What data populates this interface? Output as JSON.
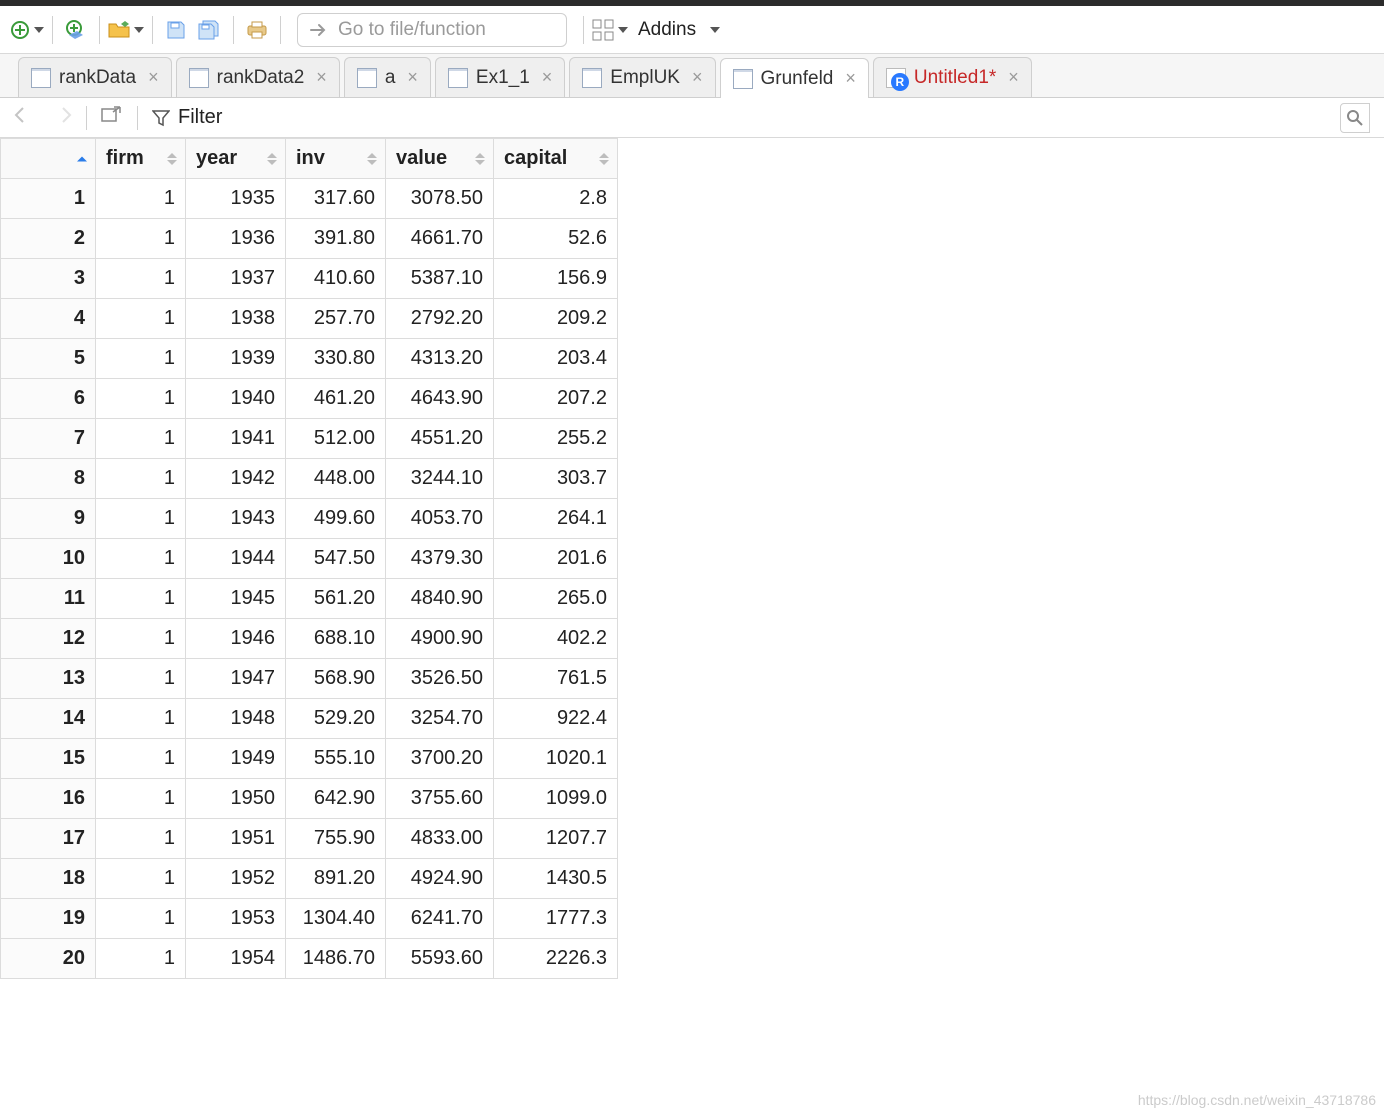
{
  "toolbar": {
    "goto_placeholder": "Go to file/function",
    "addins_label": "Addins"
  },
  "tabs": [
    {
      "label": "rankData",
      "kind": "data",
      "active": false
    },
    {
      "label": "rankData2",
      "kind": "data",
      "active": false
    },
    {
      "label": "a",
      "kind": "data",
      "active": false
    },
    {
      "label": "Ex1_1",
      "kind": "data",
      "active": false
    },
    {
      "label": "EmplUK",
      "kind": "data",
      "active": false
    },
    {
      "label": "Grunfeld",
      "kind": "data",
      "active": true
    },
    {
      "label": "Untitled1*",
      "kind": "script",
      "active": false,
      "unsaved": true
    }
  ],
  "subbar": {
    "filter_label": "Filter"
  },
  "table": {
    "columns": [
      "firm",
      "year",
      "inv",
      "value",
      "capital"
    ],
    "sort": {
      "column_index": 0,
      "dir": "asc"
    },
    "rows": [
      {
        "n": 1,
        "firm": 1,
        "year": 1935,
        "inv": "317.60",
        "value": "3078.50",
        "capital": "2.8"
      },
      {
        "n": 2,
        "firm": 1,
        "year": 1936,
        "inv": "391.80",
        "value": "4661.70",
        "capital": "52.6"
      },
      {
        "n": 3,
        "firm": 1,
        "year": 1937,
        "inv": "410.60",
        "value": "5387.10",
        "capital": "156.9"
      },
      {
        "n": 4,
        "firm": 1,
        "year": 1938,
        "inv": "257.70",
        "value": "2792.20",
        "capital": "209.2"
      },
      {
        "n": 5,
        "firm": 1,
        "year": 1939,
        "inv": "330.80",
        "value": "4313.20",
        "capital": "203.4"
      },
      {
        "n": 6,
        "firm": 1,
        "year": 1940,
        "inv": "461.20",
        "value": "4643.90",
        "capital": "207.2"
      },
      {
        "n": 7,
        "firm": 1,
        "year": 1941,
        "inv": "512.00",
        "value": "4551.20",
        "capital": "255.2"
      },
      {
        "n": 8,
        "firm": 1,
        "year": 1942,
        "inv": "448.00",
        "value": "3244.10",
        "capital": "303.7"
      },
      {
        "n": 9,
        "firm": 1,
        "year": 1943,
        "inv": "499.60",
        "value": "4053.70",
        "capital": "264.1"
      },
      {
        "n": 10,
        "firm": 1,
        "year": 1944,
        "inv": "547.50",
        "value": "4379.30",
        "capital": "201.6"
      },
      {
        "n": 11,
        "firm": 1,
        "year": 1945,
        "inv": "561.20",
        "value": "4840.90",
        "capital": "265.0"
      },
      {
        "n": 12,
        "firm": 1,
        "year": 1946,
        "inv": "688.10",
        "value": "4900.90",
        "capital": "402.2"
      },
      {
        "n": 13,
        "firm": 1,
        "year": 1947,
        "inv": "568.90",
        "value": "3526.50",
        "capital": "761.5"
      },
      {
        "n": 14,
        "firm": 1,
        "year": 1948,
        "inv": "529.20",
        "value": "3254.70",
        "capital": "922.4"
      },
      {
        "n": 15,
        "firm": 1,
        "year": 1949,
        "inv": "555.10",
        "value": "3700.20",
        "capital": "1020.1"
      },
      {
        "n": 16,
        "firm": 1,
        "year": 1950,
        "inv": "642.90",
        "value": "3755.60",
        "capital": "1099.0"
      },
      {
        "n": 17,
        "firm": 1,
        "year": 1951,
        "inv": "755.90",
        "value": "4833.00",
        "capital": "1207.7"
      },
      {
        "n": 18,
        "firm": 1,
        "year": 1952,
        "inv": "891.20",
        "value": "4924.90",
        "capital": "1430.5"
      },
      {
        "n": 19,
        "firm": 1,
        "year": 1953,
        "inv": "1304.40",
        "value": "6241.70",
        "capital": "1777.3"
      },
      {
        "n": 20,
        "firm": 1,
        "year": 1954,
        "inv": "1486.70",
        "value": "5593.60",
        "capital": "2226.3"
      }
    ]
  },
  "watermark": "https://blog.csdn.net/weixin_43718786"
}
